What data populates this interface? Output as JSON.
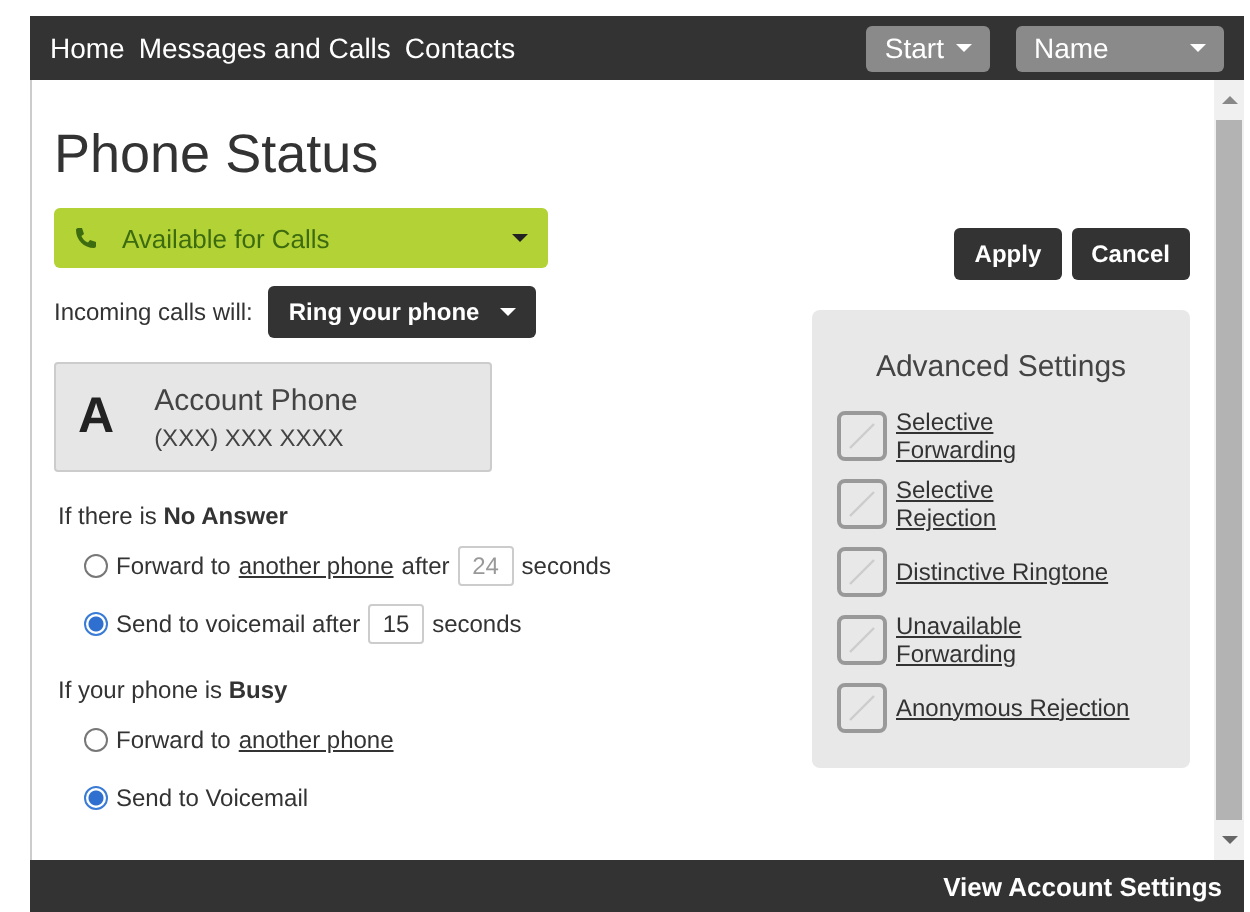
{
  "nav": {
    "links": [
      "Home",
      "Messages and Calls",
      "Contacts"
    ],
    "start_menu": "Start",
    "user_menu": "Name"
  },
  "page": {
    "title": "Phone Status",
    "status_dropdown": "Available for Calls",
    "buttons": [
      "Apply",
      "Cancel"
    ],
    "incoming": {
      "label": "Incoming calls will:",
      "value": "Ring your phone"
    },
    "account": {
      "letter": "A",
      "name": "Account Phone",
      "number": "(XXX) XXX XXXX"
    },
    "groups": [
      {
        "heading": "If there is **No Answer**",
        "options": [
          {
            "selected": false,
            "parts": [
              {
                "kind": "text",
                "text": "Forward to"
              },
              {
                "kind": "link",
                "text": "another phone"
              },
              {
                "kind": "text",
                "text": "after"
              },
              {
                "kind": "field",
                "value": "24",
                "disabled": true
              },
              {
                "kind": "text",
                "text": "seconds"
              }
            ]
          },
          {
            "selected": true,
            "parts": [
              {
                "kind": "text",
                "text": "Send to voicemail after"
              },
              {
                "kind": "field",
                "value": "15",
                "disabled": false
              },
              {
                "kind": "text",
                "text": "seconds"
              }
            ]
          }
        ]
      },
      {
        "heading": "If your phone is **Busy**",
        "options": [
          {
            "selected": false,
            "parts": [
              {
                "kind": "text",
                "text": "Forward to"
              },
              {
                "kind": "link",
                "text": "another phone"
              }
            ]
          },
          {
            "selected": true,
            "parts": [
              {
                "kind": "text",
                "text": "Send to Voicemail"
              }
            ]
          }
        ]
      }
    ],
    "advanced": {
      "title": "Advanced Settings",
      "items": [
        "Selective\nForwarding",
        "Selective\nRejection",
        "Distinctive Ringtone",
        "Unavailable\nForwarding",
        "Anonymous Rejection"
      ]
    }
  },
  "footer": {
    "link": "View Account Settings"
  }
}
